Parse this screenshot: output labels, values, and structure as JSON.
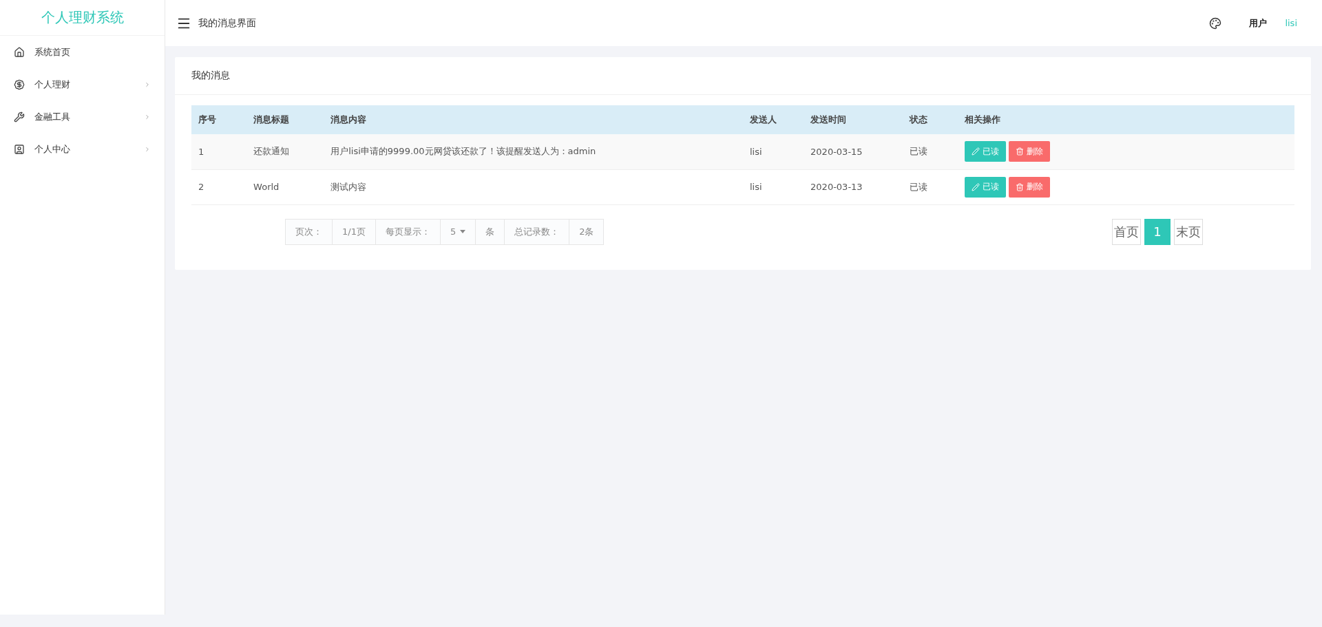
{
  "sidebar": {
    "logo": "个人理财系统",
    "items": [
      {
        "kind": "home",
        "label": "系统首页",
        "has_submenu": false
      },
      {
        "kind": "money",
        "label": "个人理财",
        "has_submenu": true
      },
      {
        "kind": "tool",
        "label": "金融工具",
        "has_submenu": true
      },
      {
        "kind": "user",
        "label": "个人中心",
        "has_submenu": true
      }
    ]
  },
  "header": {
    "title": "我的消息界面",
    "user_label": "用户",
    "username": "lisi"
  },
  "card": {
    "title": "我的消息",
    "table": {
      "columns": [
        "序号",
        "消息标题",
        "消息内容",
        "发送人",
        "发送时间",
        "状态",
        "相关操作"
      ],
      "rows": [
        {
          "cells": [
            "1",
            "还款通知",
            "用户lisi申请的9999.00元网贷该还款了！该提醒发送人为：admin",
            "lisi",
            "2020-03-15",
            "已读"
          ],
          "actions": [
            "已读",
            "删除"
          ]
        },
        {
          "cells": [
            "2",
            "World",
            "测试内容",
            "lisi",
            "2020-03-13",
            "已读"
          ],
          "actions": [
            "已读",
            "删除"
          ]
        }
      ]
    },
    "page_info": [
      {
        "kind": "text",
        "text": "页次："
      },
      {
        "kind": "text",
        "text": "1/1页"
      },
      {
        "kind": "text",
        "text": "每页显示："
      },
      {
        "kind": "select",
        "text": "5"
      },
      {
        "kind": "text",
        "text": "条"
      },
      {
        "kind": "text",
        "text": "总记录数："
      },
      {
        "kind": "text",
        "text": "2条"
      }
    ],
    "pager": [
      {
        "label": "首页",
        "selected": false
      },
      {
        "label": "1",
        "selected": true
      },
      {
        "label": "末页",
        "selected": false
      }
    ]
  }
}
